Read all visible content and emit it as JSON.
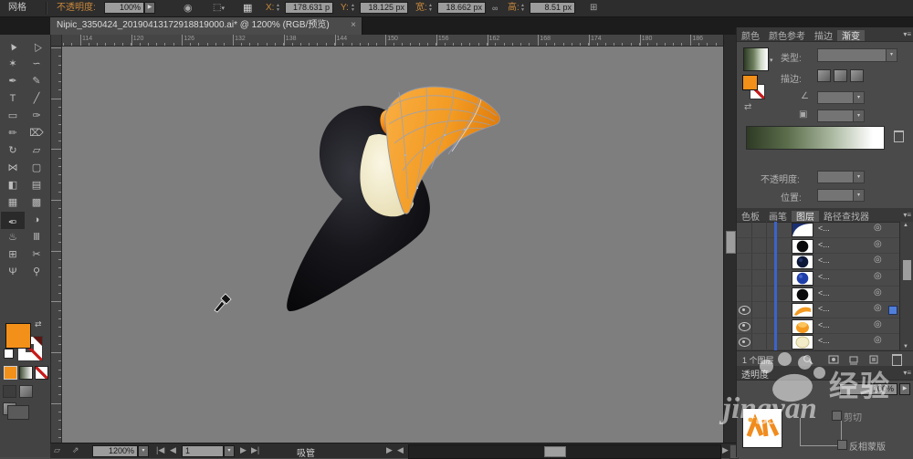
{
  "control_bar": {
    "object_type": "网格",
    "opacity_label": "不透明度:",
    "opacity_value": "100%",
    "x_label": "X:",
    "x_value": "178.631 p",
    "y_label": "Y:",
    "y_value": "18.125 px",
    "w_label": "宽:",
    "w_value": "18.662 px",
    "h_label": "高:",
    "h_value": "8.51 px"
  },
  "tab_bar": {
    "doc_title": "Nipic_3350424_20190413172918819000.ai* @ 1200% (RGB/预览)",
    "close_glyph": "×"
  },
  "toolbar": {
    "tools": [
      {
        "name": "selection",
        "glyph": "▲",
        "cls": "rot-l"
      },
      {
        "name": "direct-selection",
        "glyph": "△",
        "cls": "rot-l"
      },
      {
        "name": "magic-wand",
        "glyph": "✶"
      },
      {
        "name": "lasso",
        "glyph": "∽"
      },
      {
        "name": "pen",
        "glyph": "✒"
      },
      {
        "name": "pencil",
        "glyph": "✎"
      },
      {
        "name": "type",
        "glyph": "T"
      },
      {
        "name": "line-segment",
        "glyph": "╱"
      },
      {
        "name": "rectangle",
        "glyph": "▭"
      },
      {
        "name": "paintbrush",
        "glyph": "✑"
      },
      {
        "name": "blob-brush",
        "glyph": "✏"
      },
      {
        "name": "eraser",
        "glyph": "⌦"
      },
      {
        "name": "rotate",
        "glyph": "↻"
      },
      {
        "name": "scale",
        "glyph": "▱"
      },
      {
        "name": "width",
        "glyph": "⋈"
      },
      {
        "name": "free-transform",
        "glyph": "▢"
      },
      {
        "name": "shape-builder",
        "glyph": "◧"
      },
      {
        "name": "perspective-grid",
        "glyph": "▤"
      },
      {
        "name": "mesh",
        "glyph": "▦"
      },
      {
        "name": "gradient",
        "glyph": "▩"
      },
      {
        "name": "eyedropper",
        "glyph": "✑",
        "cls": "flip",
        "active": true
      },
      {
        "name": "blend",
        "glyph": "◑"
      },
      {
        "name": "symbol-sprayer",
        "glyph": "♨"
      },
      {
        "name": "column-graph",
        "glyph": "Ⅲ"
      },
      {
        "name": "artboard",
        "glyph": "⊞"
      },
      {
        "name": "slice",
        "glyph": "✂"
      },
      {
        "name": "hand",
        "glyph": "Ψ"
      },
      {
        "name": "zoom",
        "glyph": "⚲"
      }
    ]
  },
  "canvas": {
    "h_ruler_labels": [
      "114",
      "120",
      "126",
      "132",
      "138",
      "144",
      "150",
      "156",
      "162",
      "168",
      "174",
      "180",
      "186"
    ]
  },
  "panels": {
    "gradient": {
      "tabs": [
        "颜色",
        "颜色参考",
        "描边",
        "渐变"
      ],
      "active_tab": "渐变",
      "type_label": "类型:",
      "stroke_label": "描边:",
      "opacity_label": "不透明度:",
      "position_label": "位置:"
    },
    "layers": {
      "tabs": [
        "色板",
        "画笔",
        "图层",
        "路径查找器"
      ],
      "active_tab": "图层",
      "rows": [
        {
          "thumb": "arc-navy",
          "label": "<...",
          "eye": false,
          "selected": false
        },
        {
          "thumb": "circle-black",
          "label": "<...",
          "eye": false,
          "selected": false
        },
        {
          "thumb": "circle-darknavy",
          "label": "<...",
          "eye": false,
          "selected": false
        },
        {
          "thumb": "circle-blue",
          "label": "<...",
          "eye": false,
          "selected": false
        },
        {
          "thumb": "circle-black",
          "label": "<...",
          "eye": false,
          "selected": false
        },
        {
          "thumb": "beak-orange",
          "label": "<...",
          "eye": true,
          "selected": true
        },
        {
          "thumb": "blob-orange",
          "label": "<...",
          "eye": true,
          "selected": false
        },
        {
          "thumb": "blob-cream",
          "label": "<...",
          "eye": true,
          "selected": false
        }
      ],
      "footer": "1 个图层"
    },
    "transparency": {
      "title": "透明度",
      "opacity_value": "100%",
      "clip_label": "剪切",
      "invert_label": "反相蒙版"
    }
  },
  "status_bar": {
    "zoom_value": "1200%",
    "artboard_value": "1",
    "tool_name": "吸管"
  },
  "watermark": {
    "script_text": "jingyan",
    "cjk_text": "经验"
  },
  "colors": {
    "accent_orange": "#f39019",
    "canvas_grey": "#7e7e7e",
    "selection_blue": "#3c63cc",
    "gradient_dark_green": "#2e3a25",
    "beak_orange": "#f09a2a",
    "body_black": "#0c0c10"
  }
}
